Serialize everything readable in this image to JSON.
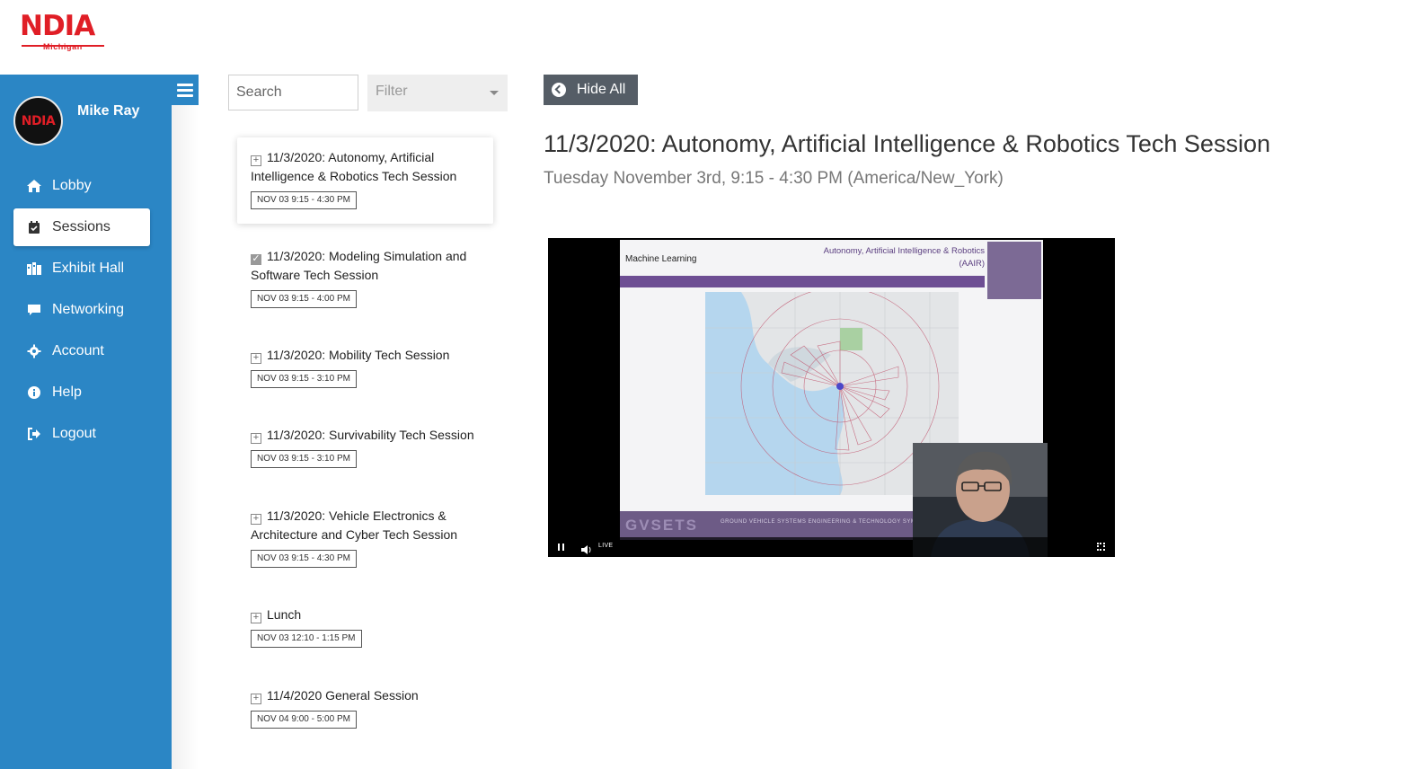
{
  "logo": {
    "brand": "NDIA",
    "sub": "Michigan"
  },
  "user": {
    "name": "Mike Ray",
    "avatar_text": "NDIA"
  },
  "nav": [
    {
      "label": "Lobby",
      "icon": "home-icon"
    },
    {
      "label": "Sessions",
      "icon": "calendar-check-icon",
      "active": true
    },
    {
      "label": "Exhibit Hall",
      "icon": "booth-icon"
    },
    {
      "label": "Networking",
      "icon": "chat-icon"
    },
    {
      "label": "Account",
      "icon": "gear-icon"
    },
    {
      "label": "Help",
      "icon": "info-icon"
    },
    {
      "label": "Logout",
      "icon": "logout-icon"
    }
  ],
  "search": {
    "placeholder": "Search"
  },
  "filter": {
    "placeholder": "Filter"
  },
  "sessions": [
    {
      "title": "11/3/2020: Autonomy, Artificial Intelligence & Robotics Tech Session",
      "time": "NOV 03 9:15 - 4:30 PM",
      "active": true,
      "checked": false
    },
    {
      "title": "11/3/2020: Modeling Simulation and Software Tech Session",
      "time": "NOV 03 9:15 - 4:00 PM",
      "checked": true
    },
    {
      "title": "11/3/2020: Mobility Tech Session",
      "time": "NOV 03 9:15 - 3:10 PM",
      "checked": false
    },
    {
      "title": "11/3/2020: Survivability Tech Session",
      "time": "NOV 03 9:15 - 3:10 PM",
      "checked": false
    },
    {
      "title": "11/3/2020: Vehicle Electronics & Architecture and Cyber Tech Session",
      "time": "NOV 03 9:15 - 4:30 PM",
      "checked": false
    },
    {
      "title": "Lunch",
      "time": "NOV 03 12:10 - 1:15 PM",
      "checked": false
    },
    {
      "title": "11/4/2020 General Session",
      "time": "NOV 04 9:00 - 5:00 PM",
      "checked": false
    }
  ],
  "main": {
    "hide_all": "Hide All",
    "title": "11/3/2020: Autonomy, Artificial Intelligence & Robotics Tech Session",
    "subtitle": "Tuesday November 3rd, 9:15 - 4:30 PM (America/New_York)"
  },
  "video": {
    "slide_left": "Machine Learning",
    "slide_right_line1": "Autonomy, Artificial Intelligence & Robotics",
    "slide_right_line2": "(AAIR)",
    "footer_brand": "GVSETS",
    "footer_text": "GROUND VEHICLE SYSTEMS ENGINEERING & TECHNOLOGY SYMPOSIUM",
    "live_label": "LIVE"
  },
  "colors": {
    "sidebar": "#2b86c5",
    "brand_red": "#e01e26",
    "button": "#555d66"
  }
}
